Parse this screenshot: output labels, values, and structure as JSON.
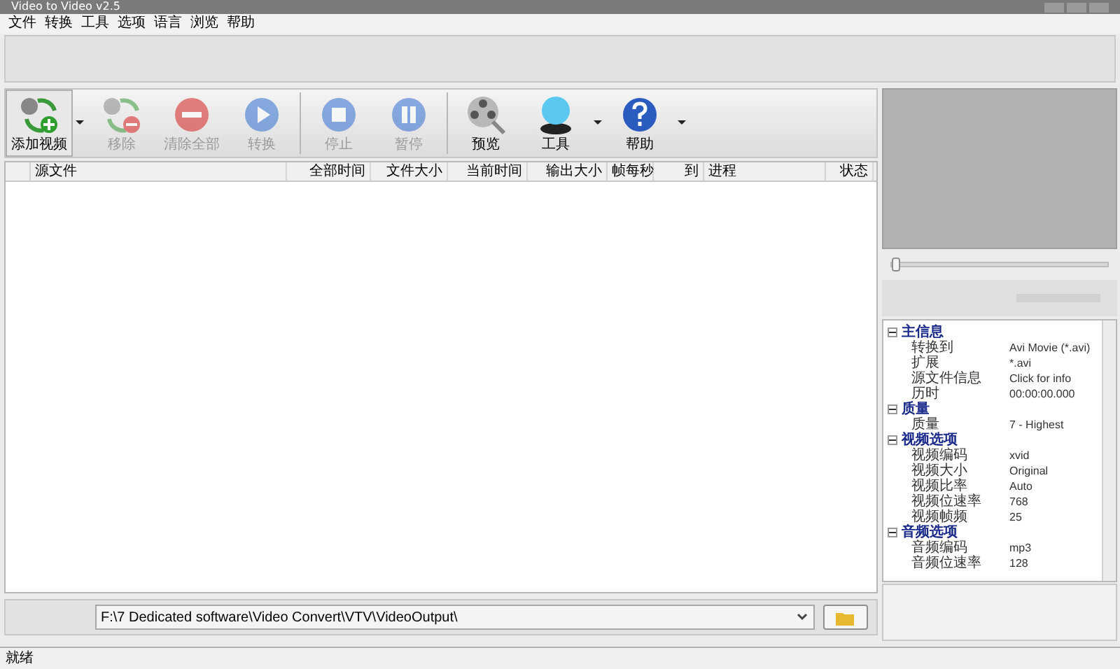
{
  "window": {
    "title": "Video to Video v2.5"
  },
  "menu": [
    "文件",
    "转换",
    "工具",
    "选项",
    "语言",
    "浏览",
    "帮助"
  ],
  "toolbar": [
    {
      "kind": "add",
      "label": "添加视频",
      "disabled": false,
      "dropdown": true
    },
    {
      "kind": "remove",
      "label": "移除",
      "disabled": true,
      "dropdown": false
    },
    {
      "kind": "clear",
      "label": "清除全部",
      "disabled": true,
      "dropdown": false
    },
    {
      "kind": "convert",
      "label": "转换",
      "disabled": true,
      "dropdown": false
    },
    {
      "kind": "stop",
      "label": "停止",
      "disabled": true,
      "dropdown": false
    },
    {
      "kind": "pause",
      "label": "暂停",
      "disabled": true,
      "dropdown": false
    },
    {
      "kind": "preview",
      "label": "预览",
      "disabled": false,
      "dropdown": false
    },
    {
      "kind": "tools",
      "label": "工具",
      "disabled": false,
      "dropdown": true
    },
    {
      "kind": "help",
      "label": "帮助",
      "disabled": false,
      "dropdown": true
    }
  ],
  "table": {
    "columns": [
      "源文件",
      "全部时间",
      "文件大小",
      "当前时间",
      "输出大小",
      "帧每秒",
      "到",
      "进程",
      "状态"
    ]
  },
  "output_path": {
    "value": "F:\\7 Dedicated software\\Video Convert\\VTV\\VideoOutput\\"
  },
  "properties": [
    {
      "name": "主信息",
      "expanded": true,
      "items": [
        {
          "name": "转换到",
          "value": "Avi Movie (*.avi)"
        },
        {
          "name": "扩展",
          "value": "*.avi"
        },
        {
          "name": "源文件信息",
          "value": "Click for info"
        },
        {
          "name": "历时",
          "value": "00:00:00.000"
        }
      ]
    },
    {
      "name": "质量",
      "expanded": true,
      "items": [
        {
          "name": "质量",
          "value": "7 - Highest"
        }
      ]
    },
    {
      "name": "视频选项",
      "expanded": true,
      "items": [
        {
          "name": "视频编码",
          "value": "xvid"
        },
        {
          "name": "视频大小",
          "value": "Original"
        },
        {
          "name": "视频比率",
          "value": "Auto"
        },
        {
          "name": "视频位速率",
          "value": "768"
        },
        {
          "name": "视频帧频",
          "value": "25"
        }
      ]
    },
    {
      "name": "音频选项",
      "expanded": true,
      "items": [
        {
          "name": "音频编码",
          "value": "mp3"
        },
        {
          "name": "音频位速率",
          "value": "128"
        }
      ]
    }
  ],
  "seek": {
    "level": 0
  },
  "status_bar": "就绪"
}
